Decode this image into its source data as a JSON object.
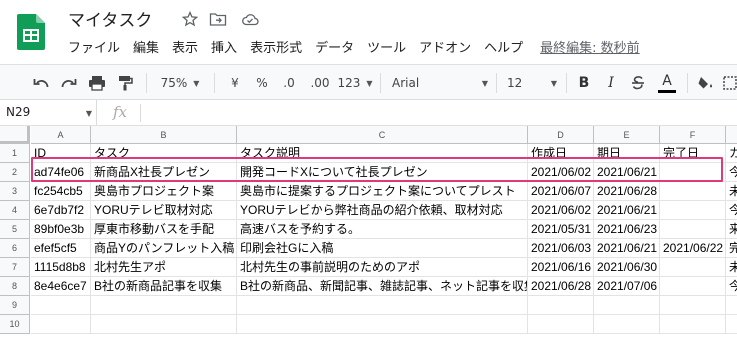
{
  "app": {
    "title": "マイタスク",
    "last_edit": "最終編集: 数秒前"
  },
  "menu": [
    "ファイル",
    "編集",
    "表示",
    "挿入",
    "表示形式",
    "データ",
    "ツール",
    "アドオン",
    "ヘルプ"
  ],
  "toolbar": {
    "zoom": "75%",
    "currency": "¥",
    "percent": "%",
    "decimal_decrease": ".0",
    "decimal_increase": ".00",
    "number_format": "123",
    "font": "Arial",
    "font_size": "12",
    "bold": "B",
    "italic": "I",
    "text_color": "A"
  },
  "formula_bar": {
    "cell_ref": "N29",
    "fx": "fx"
  },
  "columns": [
    "A",
    "B",
    "C",
    "D",
    "E",
    "F",
    "G"
  ],
  "rows": [
    {
      "num": "1",
      "cells": [
        "ID",
        "タスク",
        "タスク説明",
        "作成日",
        "期日",
        "完了日",
        "カ"
      ]
    },
    {
      "num": "2",
      "cells": [
        "ad74fe06",
        "新商品X社長プレゼン",
        "開発コードXについて社長プレゼン",
        "2021/06/02",
        "2021/06/21",
        "",
        "今"
      ]
    },
    {
      "num": "3",
      "cells": [
        "fc254cb5",
        "奥島市プロジェクト案",
        "奥島市に提案するプロジェクト案についてプレスト",
        "2021/06/07",
        "2021/06/28",
        "",
        "未"
      ]
    },
    {
      "num": "4",
      "cells": [
        "6e7db7f2",
        "YORUテレビ取材対応",
        "YORUテレビから弊社商品の紹介依頼、取材対応",
        "2021/06/02",
        "2021/06/21",
        "",
        "今"
      ]
    },
    {
      "num": "5",
      "cells": [
        "89bf0e3b",
        "厚東市移動バスを手配",
        "高速バスを予約する。",
        "2021/05/31",
        "2021/06/23",
        "",
        "来"
      ]
    },
    {
      "num": "6",
      "cells": [
        "efef5cf5",
        "商品Yのパンフレット入稿",
        "印刷会社Gに入稿",
        "2021/06/03",
        "2021/06/21",
        "2021/06/22",
        "完"
      ]
    },
    {
      "num": "7",
      "cells": [
        "1115d8b8",
        "北村先生アポ",
        "北村先生の事前説明のためのアポ",
        "2021/06/16",
        "2021/06/30",
        "",
        "未"
      ]
    },
    {
      "num": "8",
      "cells": [
        "8e4e6ce7",
        "B社の新商品記事を収集",
        "B社の新商品、新聞記事、雑誌記事、ネット記事を収集",
        "2021/06/28",
        "2021/07/06",
        "",
        "今"
      ]
    },
    {
      "num": "9",
      "cells": [
        "",
        "",
        "",
        "",
        "",
        "",
        ""
      ]
    },
    {
      "num": "10",
      "cells": [
        "",
        "",
        "",
        "",
        "",
        "",
        ""
      ]
    }
  ]
}
